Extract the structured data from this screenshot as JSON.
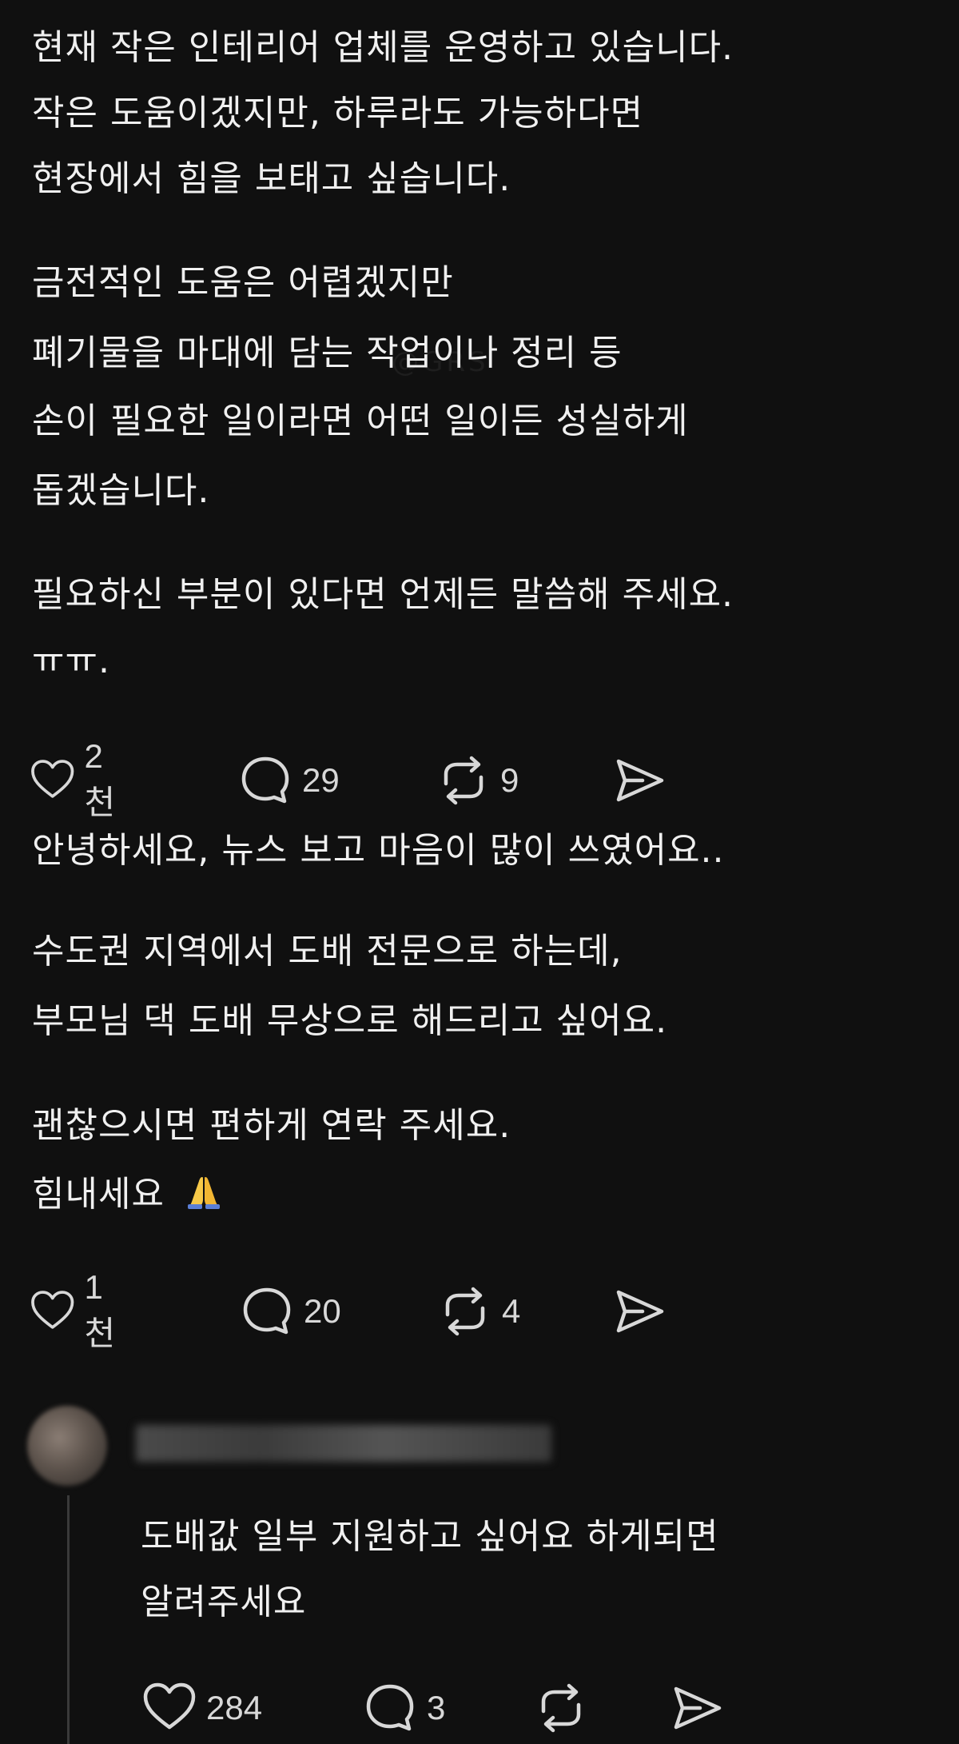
{
  "posts": [
    {
      "lines": [
        "현재 작은 인테리어 업체를 운영하고 있습니다.",
        "작은 도움이겠지만, 하루라도 가능하다면",
        "현장에서 힘을 보태고 싶습니다.",
        "금전적인 도움은 어렵겠지만",
        "폐기물을 마대에 담는 작업이나 정리 등",
        "손이 필요한 일이라면 어떤 일이든 성실하게",
        "돕겠습니다.",
        "필요하신 부분이 있다면 언제든 말씀해 주세요.",
        "ㅠㅠ."
      ],
      "likes": "2천",
      "comments": "29",
      "reposts": "9"
    },
    {
      "lines": [
        "안녕하세요, 뉴스 보고 마음이 많이 쓰였어요..",
        "수도권 지역에서 도배 전문으로 하는데,",
        "부모님 댁 도배 무상으로 해드리고 싶어요.",
        "괜찮으시면 편하게 연락 주세요.",
        "힘내세요"
      ],
      "likes": "1천",
      "comments": "20",
      "reposts": "4"
    },
    {
      "lines": [
        "도배값 일부 지원하고 싶어요 하게되면",
        "알려주세요"
      ],
      "likes": "284",
      "comments": "3",
      "reposts": ""
    }
  ],
  "watermark": "@GRS",
  "icons": {
    "like": "heart-icon",
    "comment": "comment-bubble-icon",
    "repost": "repost-icon",
    "share": "send-icon",
    "emoji": "folded-hands-emoji"
  },
  "colors": {
    "background": "#101010",
    "text": "#f0f0f0",
    "icon": "#d8d8d8"
  }
}
